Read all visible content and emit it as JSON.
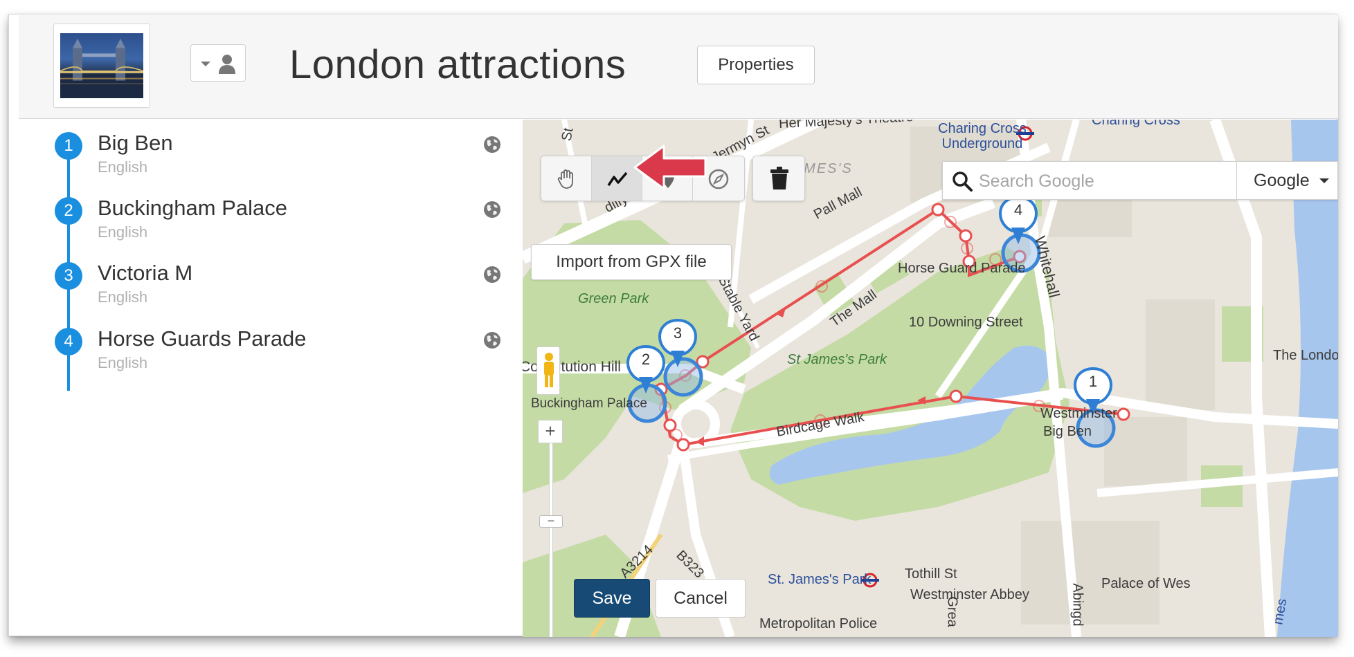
{
  "header": {
    "title": "London attractions",
    "properties_label": "Properties",
    "thumbnail_icon": "tower-bridge-photo",
    "owner_icon": "person-icon"
  },
  "list": {
    "items": [
      {
        "number": "1",
        "title": "Big Ben",
        "language": "English",
        "icon": "globe-icon"
      },
      {
        "number": "2",
        "title": "Buckingham Palace",
        "language": "English",
        "icon": "globe-icon"
      },
      {
        "number": "3",
        "title": "Victoria M",
        "language": "English",
        "icon": "globe-icon"
      },
      {
        "number": "4",
        "title": "Horse Guards Parade",
        "language": "English",
        "icon": "globe-icon"
      }
    ]
  },
  "map": {
    "toolbar": {
      "tools": [
        {
          "name": "pan",
          "icon": "hand-icon",
          "active": false
        },
        {
          "name": "draw-route",
          "icon": "line-draw-icon",
          "active": true
        },
        {
          "name": "place-marker",
          "icon": "marker-icon",
          "active": false
        },
        {
          "name": "directions",
          "icon": "compass-icon",
          "active": false
        }
      ],
      "trash_icon": "trash-icon"
    },
    "import_label": "Import from GPX file",
    "search": {
      "placeholder": "Search Google",
      "provider": "Google"
    },
    "labels": {
      "charing_cross_underground": "Charing Cross Underground",
      "charing_cross_line1": "Charing Cross",
      "charing_cross_line2": "Underground",
      "charing_cross_right": "Charing Cross",
      "her_majestys": "Her Majesty's Theatre",
      "jermyn": "Jermyn St",
      "st_james": "ST. JAMES'S",
      "pall_mall": "Pall Mall",
      "green_park": "Green Park",
      "the_mall": "The Mall",
      "stable_yard": "Stable Yard",
      "horse_guard_parade": "Horse Guard Parade",
      "whitehall": "Whitehall",
      "downing_street": "10 Downing Street",
      "st_james_park": "St James's Park",
      "constitution_hill": "Constitution Hill",
      "buckingham_palace": "Buckingham Palace",
      "birdcage_walk": "Birdcage Walk",
      "westminster": "Westminster",
      "big_ben": "Big Ben",
      "the_london": "The London",
      "st_james_park_station": "St. James's Park",
      "tothill": "Tothill St",
      "westminster_abbey": "Westminster Abbey",
      "palace_of_wes": "Palace of Wes",
      "metropolitan_police": "Metropolitan Police",
      "a3214": "A3214",
      "b323": "B323",
      "abingdon": "Abingd",
      "great": "Grea",
      "james": "mes",
      "piccadilly": "dilly",
      "st_left": "St",
      "st_top": "St"
    },
    "pins": [
      "1",
      "2",
      "3",
      "4"
    ],
    "save_label": "Save",
    "cancel_label": "Cancel",
    "zoom_in": "+",
    "zoom_out": "−"
  },
  "colors": {
    "accent": "#1a8fe0",
    "route": "#e85050",
    "save": "#174b75",
    "park": "#c9dda9",
    "water": "#a7c6ee"
  }
}
